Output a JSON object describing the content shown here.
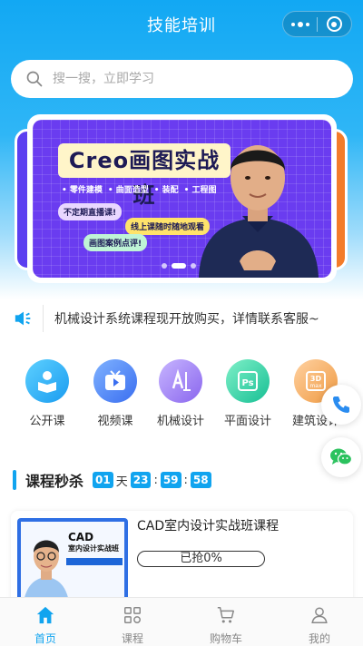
{
  "nav": {
    "title": "技能培训"
  },
  "search": {
    "placeholder": "搜一搜，立即学习"
  },
  "banner": {
    "title": "Creo画图实战班",
    "features": [
      "• 零件建模",
      "• 曲面造型",
      "• 装配",
      "• 工程图"
    ],
    "tags": [
      "不定期直播课!",
      "线上课随时随地观看",
      "画图案例点评!"
    ],
    "active_slide": 2,
    "slide_count": 3
  },
  "notice": {
    "text": "机械设计系统课程现开放购买，详情联系客服~"
  },
  "categories": [
    {
      "label": "公开课",
      "icon": "open-course-icon",
      "color": "#2aa8f2"
    },
    {
      "label": "视频课",
      "icon": "video-tv-icon",
      "color": "#3b7cf0"
    },
    {
      "label": "机械设计",
      "icon": "mechanical-design-icon",
      "color": "#8e6cf0"
    },
    {
      "label": "平面设计",
      "icon": "photoshop-icon",
      "color": "#1fc39a"
    },
    {
      "label": "建筑设计",
      "icon": "3dmax-icon",
      "color": "#f0a04b"
    }
  ],
  "flash_sale": {
    "title": "课程秒杀",
    "countdown": {
      "days": "01",
      "day_unit": "天",
      "hours": "23",
      "minutes": "59",
      "seconds": "58"
    }
  },
  "course": {
    "title": "CAD室内设计实战班课程",
    "progress_label": "已抢0%",
    "progress": 0,
    "thumb_title": "CAD",
    "thumb_subtitle": "室内设计实战班"
  },
  "tabs": [
    {
      "label": "首页",
      "icon": "home-icon",
      "active": true
    },
    {
      "label": "课程",
      "icon": "grid-course-icon",
      "active": false
    },
    {
      "label": "购物车",
      "icon": "cart-icon",
      "active": false
    },
    {
      "label": "我的",
      "icon": "user-icon",
      "active": false
    }
  ],
  "colors": {
    "brand": "#11a4ef",
    "phone": "#2a8cf0",
    "wechat": "#2bc25e"
  }
}
